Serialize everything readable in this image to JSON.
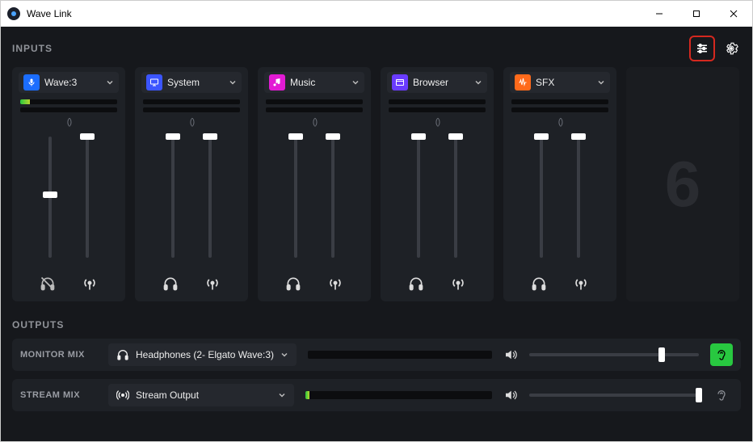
{
  "app": {
    "title": "Wave Link"
  },
  "sections": {
    "inputs": "INPUTS",
    "outputs": "OUTPUTS"
  },
  "colors": {
    "wave": "#1b6dff",
    "system": "#3b55ff",
    "music": "#e21bd4",
    "browser": "#6a3bff",
    "sfx": "#ff6a1b",
    "accent_green": "#28c840"
  },
  "channels": [
    {
      "key": "wave3",
      "label": "Wave:3",
      "icon": "mic-icon",
      "color": "wave",
      "meter_a": 10,
      "meter_b": 0,
      "slider_a": 52,
      "slider_b": 100,
      "monitor_muted": true,
      "stream_muted": false
    },
    {
      "key": "system",
      "label": "System",
      "icon": "monitor-icon",
      "color": "system",
      "meter_a": 0,
      "meter_b": 0,
      "slider_a": 100,
      "slider_b": 100,
      "monitor_muted": false,
      "stream_muted": false
    },
    {
      "key": "music",
      "label": "Music",
      "icon": "music-note-icon",
      "color": "music",
      "meter_a": 0,
      "meter_b": 0,
      "slider_a": 100,
      "slider_b": 100,
      "monitor_muted": false,
      "stream_muted": false
    },
    {
      "key": "browser",
      "label": "Browser",
      "icon": "window-icon",
      "color": "browser",
      "meter_a": 0,
      "meter_b": 0,
      "slider_a": 100,
      "slider_b": 100,
      "monitor_muted": false,
      "stream_muted": false
    },
    {
      "key": "sfx",
      "label": "SFX",
      "icon": "waveform-icon",
      "color": "sfx",
      "meter_a": 0,
      "meter_b": 0,
      "slider_a": 100,
      "slider_b": 100,
      "monitor_muted": false,
      "stream_muted": false
    }
  ],
  "placeholder_slot": "6",
  "outputs": {
    "monitor": {
      "label": "MONITOR MIX",
      "device": "Headphones (2- Elgato Wave:3)",
      "device_icon": "headphones-icon",
      "meter": 0,
      "volume": 78,
      "listen_active": true
    },
    "stream": {
      "label": "STREAM MIX",
      "device": "Stream Output",
      "device_icon": "broadcast-icon",
      "meter": 2,
      "volume": 100,
      "listen_active": false
    }
  }
}
